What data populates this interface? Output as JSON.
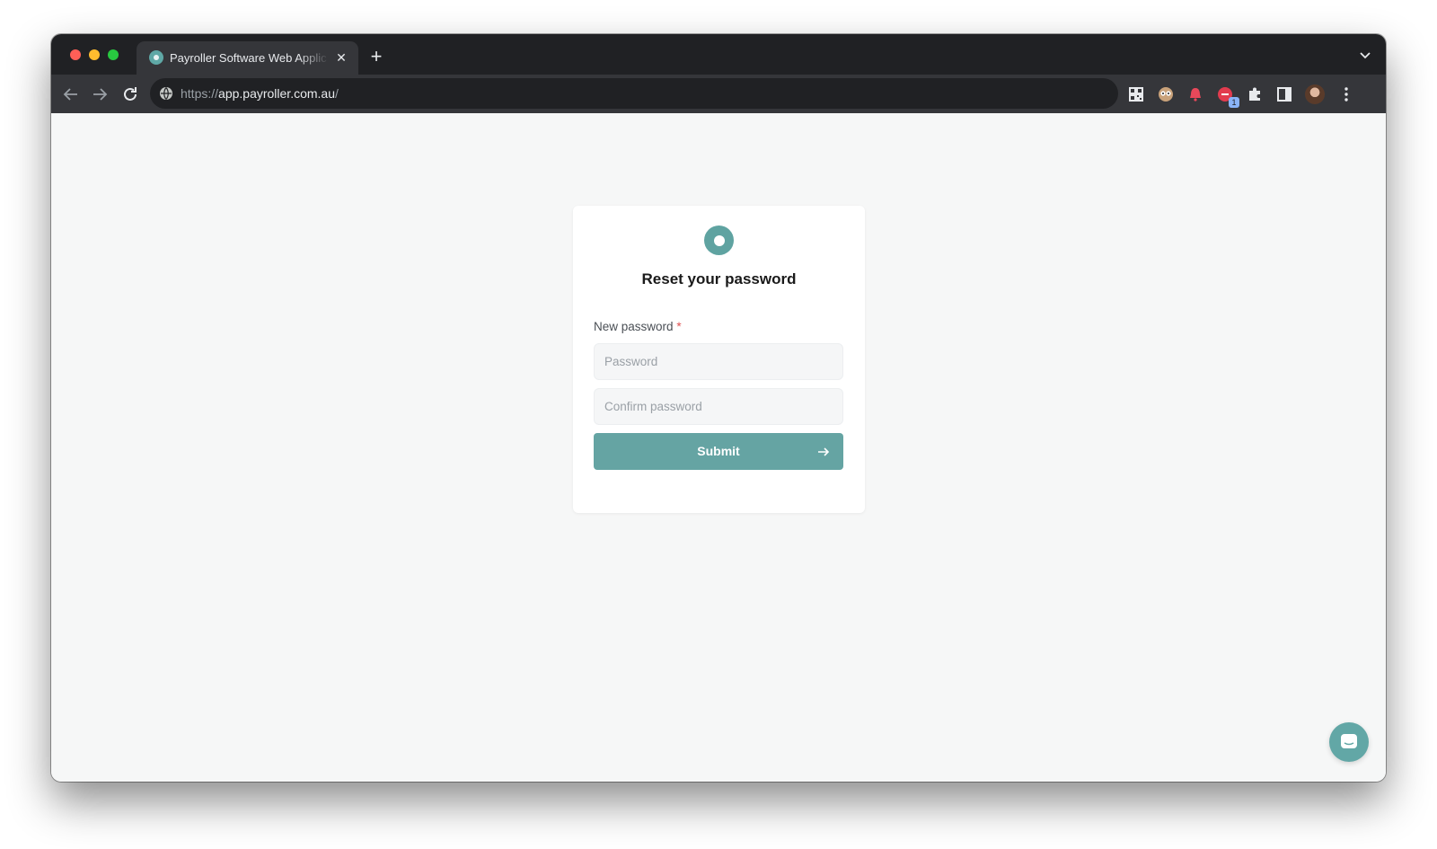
{
  "browser": {
    "tab": {
      "title": "Payroller Software Web Applic",
      "close_glyph": "✕"
    },
    "new_tab_glyph": "+",
    "url": {
      "scheme": "https://",
      "host": "app.payroller.com.au",
      "path": "/"
    },
    "extensions": [
      {
        "icon": "qr-code-icon"
      },
      {
        "icon": "eyes-extension-icon"
      },
      {
        "icon": "red-bell-extension-icon"
      },
      {
        "icon": "red-badge-extension-icon",
        "badge": "1"
      },
      {
        "icon": "puzzle-piece-icon"
      },
      {
        "icon": "side-panel-icon"
      },
      {
        "icon": "profile-avatar"
      },
      {
        "icon": "kebab-menu-icon"
      }
    ]
  },
  "page": {
    "logo": "payroller-logo-icon",
    "title": "Reset your password",
    "new_password_label": "New password",
    "required_mark": "*",
    "password_placeholder": "Password",
    "confirm_placeholder": "Confirm password",
    "submit_label": "Submit",
    "submit_icon": "arrow-right-icon",
    "chat_icon": "chat-launcher-icon"
  },
  "colors": {
    "brand_teal": "#65a4a3",
    "page_background": "#f6f7f7",
    "required_red": "#e05252",
    "browser_chrome": "#202124"
  }
}
